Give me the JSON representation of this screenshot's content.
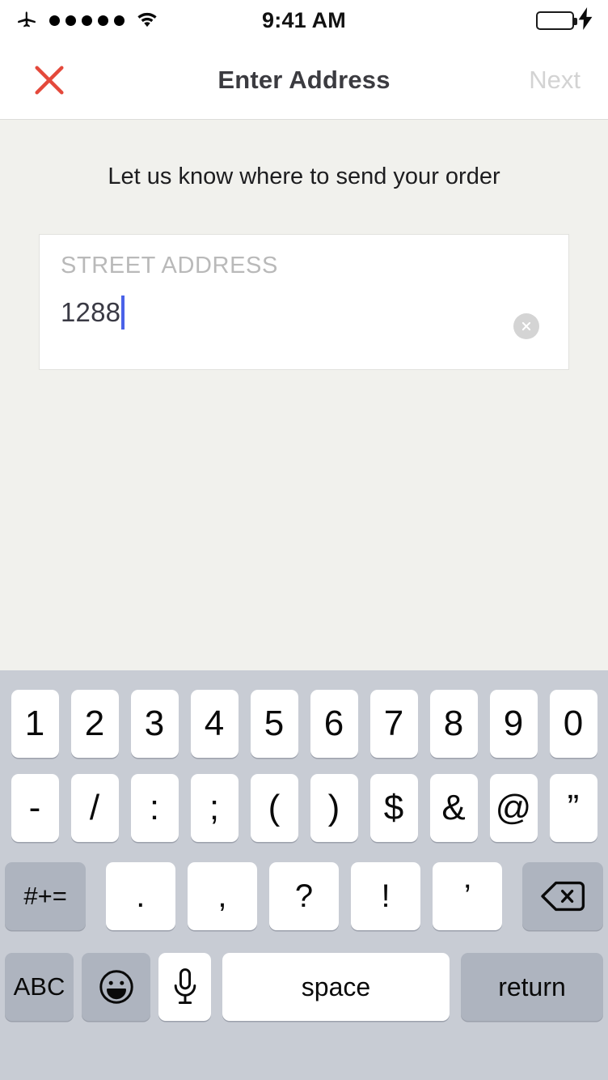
{
  "status_bar": {
    "airplane_icon": "airplane-icon",
    "signal_dots": 5,
    "wifi_icon": "wifi-icon",
    "time": "9:41 AM",
    "battery_icon": "battery-full-icon",
    "charging_icon": "lightning-bolt-icon",
    "battery_color": "#3ad15a"
  },
  "navbar": {
    "close_icon": "close-x-icon",
    "close_color": "#e4493b",
    "title": "Enter Address",
    "next_label": "Next",
    "next_color": "#d3d3d3",
    "next_enabled": false
  },
  "content": {
    "prompt": "Let us know where to send your order",
    "background": "#f1f1ed",
    "field": {
      "label": "STREET ADDRESS",
      "placeholder": "STREET ADDRESS",
      "value": "1288",
      "caret_color": "#4a62e8",
      "clear_icon": "clear-circle-x-icon",
      "focused": true
    }
  },
  "keyboard": {
    "type": "numeric-symbols",
    "background": "#c8ccd4",
    "row1": [
      "1",
      "2",
      "3",
      "4",
      "5",
      "6",
      "7",
      "8",
      "9",
      "0"
    ],
    "row2": [
      "-",
      "/",
      ":",
      ";",
      "(",
      ")",
      "$",
      "&",
      "@",
      "”"
    ],
    "row3": {
      "symbols_key": "#+=",
      "keys": [
        ".",
        ",",
        "?",
        "!",
        "’"
      ],
      "backspace_icon": "backspace-delete-icon"
    },
    "row4": {
      "abc_label": "ABC",
      "emoji_icon": "emoji-smiley-icon",
      "mic_icon": "microphone-icon",
      "space_label": "space",
      "return_label": "return"
    }
  }
}
